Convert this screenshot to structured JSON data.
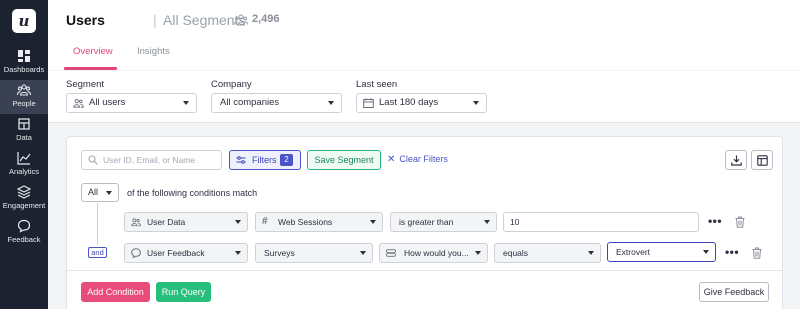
{
  "sidebar": {
    "logo": "u",
    "items": [
      {
        "label": "Dashboards",
        "icon": "dashboard-icon"
      },
      {
        "label": "People",
        "icon": "people-icon",
        "active": true
      },
      {
        "label": "Data",
        "icon": "data-icon"
      },
      {
        "label": "Analytics",
        "icon": "analytics-icon"
      },
      {
        "label": "Engagement",
        "icon": "engagement-icon"
      },
      {
        "label": "Feedback",
        "icon": "feedback-icon"
      }
    ]
  },
  "header": {
    "title": "Users",
    "separator": "|",
    "subtitle": "All Segments",
    "count": "2,496",
    "tabs": [
      {
        "label": "Overview",
        "active": true
      },
      {
        "label": "Insights",
        "active": false
      }
    ]
  },
  "filters": {
    "segment": {
      "label": "Segment",
      "value": "All users"
    },
    "company": {
      "label": "Company",
      "value": "All companies"
    },
    "last_seen": {
      "label": "Last seen",
      "value": "Last 180 days"
    }
  },
  "query": {
    "search_placeholder": "User ID, Email, or Name",
    "filters_label": "Filters",
    "filters_count": "2",
    "save_segment": "Save Segment",
    "clear_filters": "Clear Filters",
    "match_mode": "All",
    "match_text": "of the following conditions match",
    "and_label": "and",
    "conditions": [
      {
        "source": "User Data",
        "field": "Web Sessions",
        "operator": "is greater than",
        "value": "10"
      },
      {
        "source": "User Feedback",
        "field": "Surveys",
        "question": "How would you...",
        "operator": "equals",
        "value": "Extrovert"
      }
    ],
    "add_condition": "Add Condition",
    "run_query": "Run Query",
    "give_feedback": "Give Feedback"
  },
  "colors": {
    "sidebar_bg": "#1d2230",
    "accent_pink": "#e0457b",
    "accent_indigo": "#4a55c7",
    "accent_green": "#27bf7b"
  }
}
